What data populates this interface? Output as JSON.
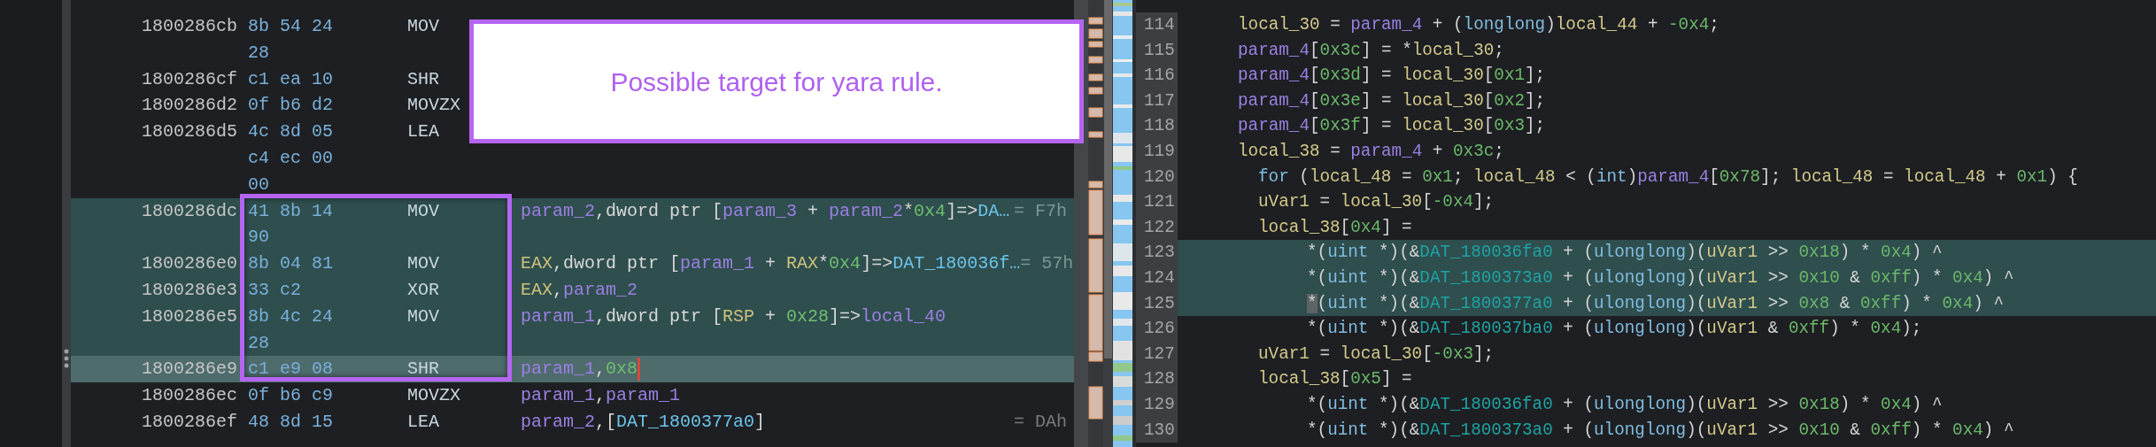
{
  "listing": {
    "rows": [
      {
        "address": "1800286cb",
        "bytes": "8b 54 24",
        "mnemonic": "MOV",
        "highlighted": false,
        "selected": false
      },
      {
        "bytes": "28",
        "highlighted": false,
        "selected": false
      },
      {
        "address": "1800286cf",
        "bytes": "c1 ea 10",
        "mnemonic": "SHR",
        "highlighted": false,
        "selected": false
      },
      {
        "address": "1800286d2",
        "bytes": "0f b6 d2",
        "mnemonic": "MOVZX",
        "highlighted": false,
        "selected": false
      },
      {
        "address": "1800286d5",
        "bytes": "4c 8d 05",
        "mnemonic": "LEA",
        "highlighted": false,
        "selected": false
      },
      {
        "bytes": "c4 ec 00",
        "highlighted": false,
        "selected": false,
        "caret": false
      },
      {
        "bytes": "00",
        "highlighted": false,
        "selected": false,
        "caret": false
      },
      {
        "address": "1800286dc",
        "bytes": "41 8b 14",
        "mnemonic": "MOV",
        "operands": [
          {
            "text": "param_2",
            "kind": "var"
          },
          {
            "text": ",dword ptr [",
            "kind": "plain"
          },
          {
            "text": "param_3",
            "kind": "var"
          },
          {
            "text": " + ",
            "kind": "plain"
          },
          {
            "text": "param_2",
            "kind": "var"
          },
          {
            "text": "*",
            "kind": "plain"
          },
          {
            "text": "0x4",
            "kind": "num"
          },
          {
            "text": "]=>",
            "kind": "plain"
          },
          {
            "text": "DA…",
            "kind": "data"
          }
        ],
        "comment": "= F7h",
        "highlighted": true,
        "selected": false,
        "caret": false
      },
      {
        "bytes": "90",
        "highlighted": true,
        "selected": false,
        "caret": false
      },
      {
        "address": "1800286e0",
        "bytes": "8b 04 81",
        "mnemonic": "MOV",
        "operands": [
          {
            "text": "EAX",
            "kind": "reg"
          },
          {
            "text": ",dword ptr [",
            "kind": "plain"
          },
          {
            "text": "param_1",
            "kind": "var"
          },
          {
            "text": " + ",
            "kind": "plain"
          },
          {
            "text": "RAX",
            "kind": "reg"
          },
          {
            "text": "*",
            "kind": "plain"
          },
          {
            "text": "0x4",
            "kind": "num"
          },
          {
            "text": "]=>",
            "kind": "plain"
          },
          {
            "text": "DAT_180036f…",
            "kind": "data"
          }
        ],
        "comment": "= 57h",
        "highlighted": true,
        "selected": false,
        "caret": false
      },
      {
        "address": "1800286e3",
        "bytes": "33 c2",
        "mnemonic": "XOR",
        "operands": [
          {
            "text": "EAX",
            "kind": "reg"
          },
          {
            "text": ",",
            "kind": "plain"
          },
          {
            "text": "param_2",
            "kind": "var"
          }
        ],
        "highlighted": true,
        "selected": false,
        "caret": false
      },
      {
        "address": "1800286e5",
        "bytes": "8b 4c 24",
        "mnemonic": "MOV",
        "operands": [
          {
            "text": "param_1",
            "kind": "var"
          },
          {
            "text": ",dword ptr [",
            "kind": "plain"
          },
          {
            "text": "RSP",
            "kind": "reg"
          },
          {
            "text": " + ",
            "kind": "plain"
          },
          {
            "text": "0x28",
            "kind": "num"
          },
          {
            "text": "]=>",
            "kind": "plain"
          },
          {
            "text": "local_40",
            "kind": "var"
          }
        ],
        "highlighted": true,
        "selected": false,
        "caret": false
      },
      {
        "bytes": "28",
        "highlighted": true,
        "selected": false,
        "caret": false
      },
      {
        "address": "1800286e9",
        "bytes": "c1 e9 08",
        "mnemonic": "SHR",
        "operands": [
          {
            "text": "param_1",
            "kind": "var"
          },
          {
            "text": ",",
            "kind": "plain"
          },
          {
            "text": "0x8",
            "kind": "num"
          }
        ],
        "highlighted": false,
        "selected": true,
        "caret": true
      },
      {
        "address": "1800286ec",
        "bytes": "0f b6 c9",
        "mnemonic": "MOVZX",
        "operands": [
          {
            "text": "param_1",
            "kind": "var"
          },
          {
            "text": ",",
            "kind": "plain"
          },
          {
            "text": "param_1",
            "kind": "var"
          }
        ],
        "highlighted": false,
        "selected": false,
        "caret": false
      },
      {
        "address": "1800286ef",
        "bytes": "48 8d 15",
        "mnemonic": "LEA",
        "operands": [
          {
            "text": "param_2",
            "kind": "var"
          },
          {
            "text": ",[",
            "kind": "plain"
          },
          {
            "text": "DAT_1800377a0",
            "kind": "data"
          },
          {
            "text": "]",
            "kind": "plain"
          }
        ],
        "comment": "= DAh",
        "highlighted": false,
        "selected": false,
        "caret": false
      }
    ]
  },
  "decompiler": {
    "lines": [
      {
        "number": "114",
        "highlighted": false,
        "tokens": [
          {
            "text": "local_30",
            "kind": "local"
          },
          {
            "text": " = ",
            "kind": "plain"
          },
          {
            "text": "param_4",
            "kind": "param"
          },
          {
            "text": " + (",
            "kind": "plain"
          },
          {
            "text": "longlong",
            "kind": "type"
          },
          {
            "text": ")",
            "kind": "plain"
          },
          {
            "text": "local_44",
            "kind": "local"
          },
          {
            "text": " + ",
            "kind": "plain"
          },
          {
            "text": "-0x4",
            "kind": "num"
          },
          {
            "text": ";",
            "kind": "plain"
          }
        ]
      },
      {
        "number": "115",
        "highlighted": false,
        "tokens": [
          {
            "text": "param_4",
            "kind": "param"
          },
          {
            "text": "[",
            "kind": "plain"
          },
          {
            "text": "0x3c",
            "kind": "num"
          },
          {
            "text": "] = *",
            "kind": "plain"
          },
          {
            "text": "local_30",
            "kind": "local"
          },
          {
            "text": ";",
            "kind": "plain"
          }
        ]
      },
      {
        "number": "116",
        "highlighted": false,
        "tokens": [
          {
            "text": "param_4",
            "kind": "param"
          },
          {
            "text": "[",
            "kind": "plain"
          },
          {
            "text": "0x3d",
            "kind": "num"
          },
          {
            "text": "] = ",
            "kind": "plain"
          },
          {
            "text": "local_30",
            "kind": "local"
          },
          {
            "text": "[",
            "kind": "plain"
          },
          {
            "text": "0x1",
            "kind": "num"
          },
          {
            "text": "];",
            "kind": "plain"
          }
        ]
      },
      {
        "number": "117",
        "highlighted": false,
        "tokens": [
          {
            "text": "param_4",
            "kind": "param"
          },
          {
            "text": "[",
            "kind": "plain"
          },
          {
            "text": "0x3e",
            "kind": "num"
          },
          {
            "text": "] = ",
            "kind": "plain"
          },
          {
            "text": "local_30",
            "kind": "local"
          },
          {
            "text": "[",
            "kind": "plain"
          },
          {
            "text": "0x2",
            "kind": "num"
          },
          {
            "text": "];",
            "kind": "plain"
          }
        ]
      },
      {
        "number": "118",
        "highlighted": false,
        "tokens": [
          {
            "text": "param_4",
            "kind": "param"
          },
          {
            "text": "[",
            "kind": "plain"
          },
          {
            "text": "0x3f",
            "kind": "num"
          },
          {
            "text": "] = ",
            "kind": "plain"
          },
          {
            "text": "local_30",
            "kind": "local"
          },
          {
            "text": "[",
            "kind": "plain"
          },
          {
            "text": "0x3",
            "kind": "num"
          },
          {
            "text": "];",
            "kind": "plain"
          }
        ]
      },
      {
        "number": "119",
        "highlighted": false,
        "tokens": [
          {
            "text": "local_38",
            "kind": "local"
          },
          {
            "text": " = ",
            "kind": "plain"
          },
          {
            "text": "param_4",
            "kind": "param"
          },
          {
            "text": " + ",
            "kind": "plain"
          },
          {
            "text": "0x3c",
            "kind": "num"
          },
          {
            "text": ";",
            "kind": "plain"
          }
        ]
      },
      {
        "number": "120",
        "highlighted": false,
        "tokens": [
          {
            "text": "for",
            "kind": "type"
          },
          {
            "text": " (",
            "kind": "plain"
          },
          {
            "text": "local_48",
            "kind": "local"
          },
          {
            "text": " = ",
            "kind": "plain"
          },
          {
            "text": "0x1",
            "kind": "num"
          },
          {
            "text": "; ",
            "kind": "plain"
          },
          {
            "text": "local_48",
            "kind": "local"
          },
          {
            "text": " < (",
            "kind": "plain"
          },
          {
            "text": "int",
            "kind": "type"
          },
          {
            "text": ")",
            "kind": "plain"
          },
          {
            "text": "param_4",
            "kind": "param"
          },
          {
            "text": "[",
            "kind": "plain"
          },
          {
            "text": "0x78",
            "kind": "num"
          },
          {
            "text": "]; ",
            "kind": "plain"
          },
          {
            "text": "local_48",
            "kind": "local"
          },
          {
            "text": " = ",
            "kind": "plain"
          },
          {
            "text": "local_48",
            "kind": "local"
          },
          {
            "text": " + ",
            "kind": "plain"
          },
          {
            "text": "0x1",
            "kind": "num"
          },
          {
            "text": ") {",
            "kind": "plain"
          }
        ]
      },
      {
        "number": "121",
        "highlighted": false,
        "tokens": [
          {
            "text": "uVar1",
            "kind": "local"
          },
          {
            "text": " = ",
            "kind": "plain"
          },
          {
            "text": "local_30",
            "kind": "local"
          },
          {
            "text": "[",
            "kind": "plain"
          },
          {
            "text": "-0x4",
            "kind": "num"
          },
          {
            "text": "];",
            "kind": "plain"
          }
        ]
      },
      {
        "number": "122",
        "highlighted": false,
        "tokens": [
          {
            "text": "local_38",
            "kind": "local"
          },
          {
            "text": "[",
            "kind": "plain"
          },
          {
            "text": "0x4",
            "kind": "num"
          },
          {
            "text": "] =",
            "kind": "plain"
          }
        ],
        "children": [
          {
            "number": "123",
            "highlighted": true,
            "tokens": [
              {
                "text": "*(",
                "kind": "plain"
              },
              {
                "text": "uint",
                "kind": "type"
              },
              {
                "text": " *)(&",
                "kind": "plain"
              },
              {
                "text": "DAT_180036fa0",
                "kind": "global"
              },
              {
                "text": " + (",
                "kind": "plain"
              },
              {
                "text": "ulonglong",
                "kind": "type"
              },
              {
                "text": ")(",
                "kind": "plain"
              },
              {
                "text": "uVar1",
                "kind": "local"
              },
              {
                "text": " >> ",
                "kind": "plain"
              },
              {
                "text": "0x18",
                "kind": "num"
              },
              {
                "text": ") * ",
                "kind": "plain"
              },
              {
                "text": "0x4",
                "kind": "num"
              },
              {
                "text": ") ^",
                "kind": "plain"
              }
            ]
          },
          {
            "number": "124",
            "highlighted": true,
            "tokens": [
              {
                "text": "*(",
                "kind": "plain"
              },
              {
                "text": "uint",
                "kind": "type"
              },
              {
                "text": " *)(&",
                "kind": "plain"
              },
              {
                "text": "DAT_1800373a0",
                "kind": "global"
              },
              {
                "text": " + (",
                "kind": "plain"
              },
              {
                "text": "ulonglong",
                "kind": "type"
              },
              {
                "text": ")(",
                "kind": "plain"
              },
              {
                "text": "uVar1",
                "kind": "local"
              },
              {
                "text": " >> ",
                "kind": "plain"
              },
              {
                "text": "0x10",
                "kind": "num"
              },
              {
                "text": " & ",
                "kind": "plain"
              },
              {
                "text": "0xff",
                "kind": "num"
              },
              {
                "text": ") * ",
                "kind": "plain"
              },
              {
                "text": "0x4",
                "kind": "num"
              },
              {
                "text": ") ^",
                "kind": "plain"
              }
            ]
          },
          {
            "number": "125",
            "highlighted": true,
            "tokens": [
              {
                "text": "*",
                "kind": "cursor"
              },
              {
                "text": "(",
                "kind": "plain"
              },
              {
                "text": "uint",
                "kind": "type"
              },
              {
                "text": " *)(&",
                "kind": "plain"
              },
              {
                "text": "DAT_1800377a0",
                "kind": "global"
              },
              {
                "text": " + (",
                "kind": "plain"
              },
              {
                "text": "ulonglong",
                "kind": "type"
              },
              {
                "text": ")(",
                "kind": "plain"
              },
              {
                "text": "uVar1",
                "kind": "local"
              },
              {
                "text": " >> ",
                "kind": "plain"
              },
              {
                "text": "0x8",
                "kind": "num"
              },
              {
                "text": " & ",
                "kind": "plain"
              },
              {
                "text": "0xff",
                "kind": "num"
              },
              {
                "text": ") * ",
                "kind": "plain"
              },
              {
                "text": "0x4",
                "kind": "num"
              },
              {
                "text": ") ^",
                "kind": "plain"
              }
            ]
          },
          {
            "number": "126",
            "highlighted": false,
            "tokens": [
              {
                "text": "*(",
                "kind": "plain"
              },
              {
                "text": "uint",
                "kind": "type"
              },
              {
                "text": " *)(&",
                "kind": "plain"
              },
              {
                "text": "DAT_180037ba0",
                "kind": "global"
              },
              {
                "text": " + (",
                "kind": "plain"
              },
              {
                "text": "ulonglong",
                "kind": "type"
              },
              {
                "text": ")(",
                "kind": "plain"
              },
              {
                "text": "uVar1",
                "kind": "local"
              },
              {
                "text": " & ",
                "kind": "plain"
              },
              {
                "text": "0xff",
                "kind": "num"
              },
              {
                "text": ") * ",
                "kind": "plain"
              },
              {
                "text": "0x4",
                "kind": "num"
              },
              {
                "text": ");",
                "kind": "plain"
              }
            ]
          }
        ]
      },
      {
        "number": "127",
        "highlighted": false,
        "tokens": [
          {
            "text": "uVar1",
            "kind": "local"
          },
          {
            "text": " = ",
            "kind": "plain"
          },
          {
            "text": "local_30",
            "kind": "local"
          },
          {
            "text": "[",
            "kind": "plain"
          },
          {
            "text": "-0x3",
            "kind": "num"
          },
          {
            "text": "];",
            "kind": "plain"
          }
        ]
      },
      {
        "number": "128",
        "highlighted": false,
        "tokens": [
          {
            "text": "local_38",
            "kind": "local"
          },
          {
            "text": "[",
            "kind": "plain"
          },
          {
            "text": "0x5",
            "kind": "num"
          },
          {
            "text": "] =",
            "kind": "plain"
          }
        ],
        "children": [
          {
            "number": "129",
            "highlighted": false,
            "tokens": [
              {
                "text": "*(",
                "kind": "plain"
              },
              {
                "text": "uint",
                "kind": "type"
              },
              {
                "text": " *)(&",
                "kind": "plain"
              },
              {
                "text": "DAT_180036fa0",
                "kind": "global"
              },
              {
                "text": " + (",
                "kind": "plain"
              },
              {
                "text": "ulonglong",
                "kind": "type"
              },
              {
                "text": ")(",
                "kind": "plain"
              },
              {
                "text": "uVar1",
                "kind": "local"
              },
              {
                "text": " >> ",
                "kind": "plain"
              },
              {
                "text": "0x18",
                "kind": "num"
              },
              {
                "text": ") * ",
                "kind": "plain"
              },
              {
                "text": "0x4",
                "kind": "num"
              },
              {
                "text": ") ^",
                "kind": "plain"
              }
            ]
          },
          {
            "number": "130",
            "highlighted": false,
            "tokens": [
              {
                "text": "*(",
                "kind": "plain"
              },
              {
                "text": "uint",
                "kind": "type"
              },
              {
                "text": " *)(&",
                "kind": "plain"
              },
              {
                "text": "DAT_1800373a0",
                "kind": "global"
              },
              {
                "text": " + (",
                "kind": "plain"
              },
              {
                "text": "ulonglong",
                "kind": "type"
              },
              {
                "text": ")(",
                "kind": "plain"
              },
              {
                "text": "uVar1",
                "kind": "local"
              },
              {
                "text": " >> ",
                "kind": "plain"
              },
              {
                "text": "0x10",
                "kind": "num"
              },
              {
                "text": " & ",
                "kind": "plain"
              },
              {
                "text": "0xff",
                "kind": "num"
              },
              {
                "text": ") * ",
                "kind": "plain"
              },
              {
                "text": "0x4",
                "kind": "num"
              },
              {
                "text": ") ^",
                "kind": "plain"
              }
            ]
          }
        ]
      }
    ]
  },
  "annotations": [
    {
      "kind": "callout",
      "text": "Possible target for yara rule."
    },
    {
      "kind": "frame"
    }
  ]
}
